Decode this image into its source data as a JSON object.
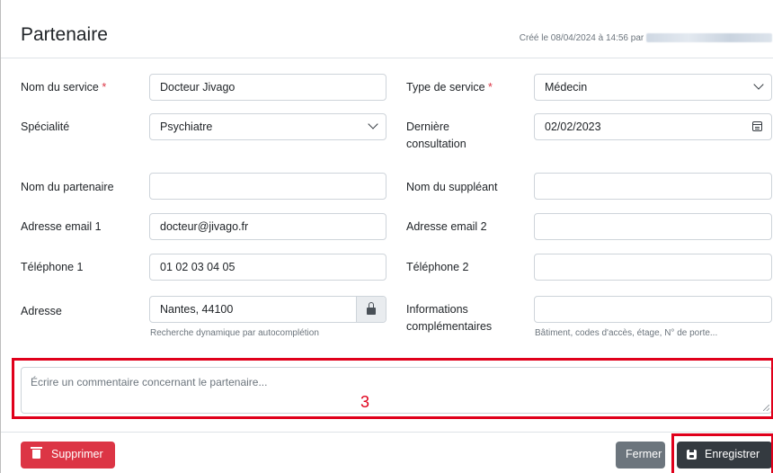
{
  "header": {
    "title": "Partenaire",
    "created": "Créé le 08/04/2024 à 14:56 par"
  },
  "form": {
    "nom_service": {
      "label": "Nom du service",
      "required_mark": "*",
      "value": "Docteur Jivago"
    },
    "type_service": {
      "label": "Type de service",
      "required_mark": "*",
      "value": "Médecin"
    },
    "specialite": {
      "label": "Spécialité",
      "value": "Psychiatre"
    },
    "derniere_consultation": {
      "label_line1": "Dernière",
      "label_line2": "consultation",
      "value": "02/02/2023"
    },
    "nom_partenaire": {
      "label": "Nom du partenaire",
      "value": ""
    },
    "nom_suppleant": {
      "label": "Nom du suppléant",
      "value": ""
    },
    "email1": {
      "label": "Adresse email 1",
      "value": "docteur@jivago.fr"
    },
    "email2": {
      "label": "Adresse email 2",
      "value": ""
    },
    "tel1": {
      "label": "Téléphone 1",
      "value": "01 02 03 04 05"
    },
    "tel2": {
      "label": "Téléphone 2",
      "value": ""
    },
    "adresse": {
      "label": "Adresse",
      "value": "Nantes, 44100",
      "help": "Recherche dynamique par autocomplétion"
    },
    "infos": {
      "label_line1": "Informations",
      "label_line2": "complémentaires",
      "value": "",
      "help": "Bâtiment, codes d'accès, étage, N° de porte..."
    },
    "commentaire": {
      "placeholder": "Écrire un commentaire concernant le partenaire..."
    }
  },
  "annotation": {
    "number": "3",
    "color": "#e0001b"
  },
  "footer": {
    "delete_label": "Supprimer",
    "close_label": "Fermer",
    "save_label": "Enregistrer"
  },
  "colors": {
    "danger": "#dc3545",
    "secondary": "#6c757d",
    "dark": "#343a40",
    "annotation_red": "#e0001b"
  },
  "icons": [
    "trash-icon",
    "floppy-disk-icon",
    "lock-icon",
    "calendar-icon",
    "chevron-down-icon"
  ]
}
